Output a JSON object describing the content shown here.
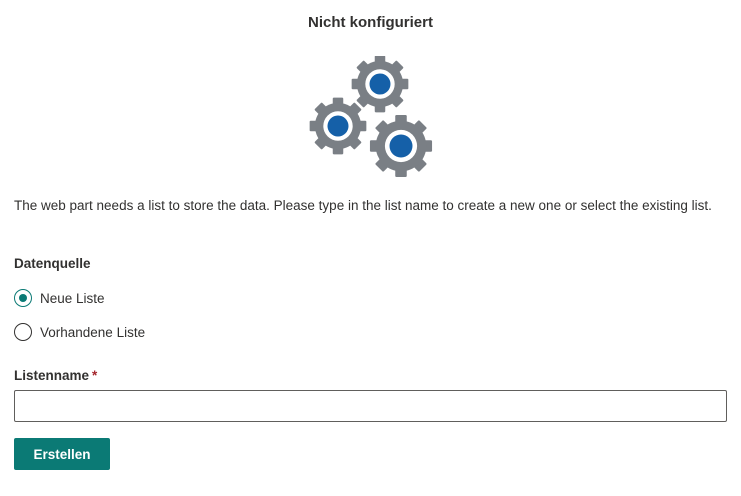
{
  "header": {
    "title": "Nicht konfiguriert"
  },
  "illustration": {
    "icon": "gears-icon",
    "gear_color": "#7a7f85",
    "hub_color": "#1560a8"
  },
  "description": "The web part needs a list to store the data. Please type in the list name to create a new one or select the existing list.",
  "datasource": {
    "label": "Datenquelle",
    "options": [
      {
        "label": "Neue Liste",
        "checked": true
      },
      {
        "label": "Vorhandene Liste",
        "checked": false
      }
    ]
  },
  "listname": {
    "label": "Listenname",
    "required_mark": "*",
    "value": ""
  },
  "actions": {
    "create_label": "Erstellen"
  },
  "colors": {
    "accent": "#0b7a75",
    "required": "#a4262c",
    "text": "#323130"
  }
}
